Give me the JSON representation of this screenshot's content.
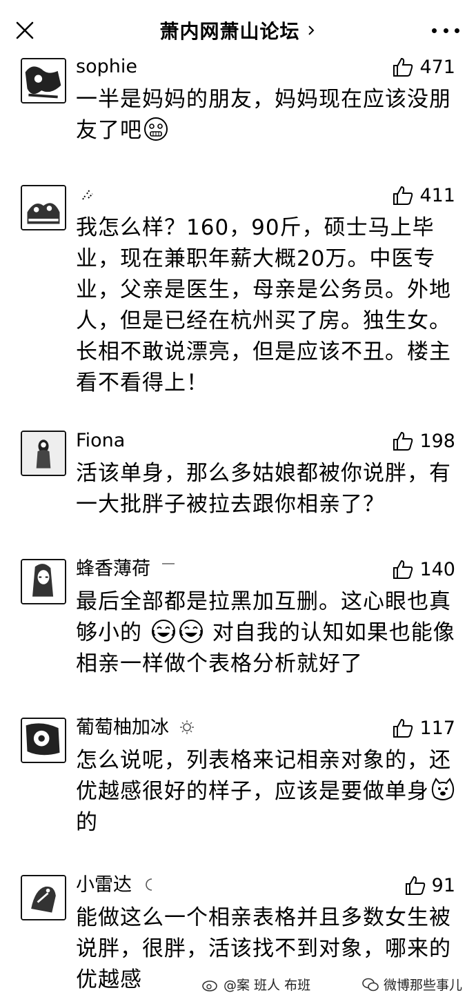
{
  "header": {
    "title": "萧内网萧山论坛",
    "close_icon": "close-icon",
    "more_icon": "more-icon"
  },
  "comments": [
    {
      "user": "sophie",
      "likes": "471",
      "text": "一半是妈妈的朋友，妈妈现在应该没朋友了吧",
      "emoji": "grimace-emoji"
    },
    {
      "user": "",
      "likes": "411",
      "text": "我怎么样？160，90斤，硕士马上毕业，现在兼职年薪大概20万。中医专业，父亲是医生，母亲是公务员。外地人，但是已经在杭州买了房。独生女。长相不敢说漂亮，但是应该不丑。楼主看不看得上！"
    },
    {
      "user": "Fiona",
      "likes": "198",
      "text": "活该单身，那么多姑娘都被你说胖，有一大批胖子被拉去跟你相亲了？"
    },
    {
      "user": "蜂香薄荷",
      "likes": "140",
      "text_a": "最后全部都是拉黑加互删。这心眼也真够小的",
      "text_b": "对自我的认知如果也能像相亲一样做个表格分析就好了",
      "emoji": "laugh-cry-emoji"
    },
    {
      "user": "葡萄柚加冰",
      "likes": "117",
      "text_a": "怎么说呢，列表格来记相亲对象的，还优越感很好的样子，应该是要做单身",
      "text_b": "的",
      "emoji": "doge-emoji"
    },
    {
      "user": "小雷达",
      "likes": "91",
      "text": "能做这么一个相亲表格并且多数女生被说胖，很胖，活该找不到对象，哪来的优越感"
    }
  ],
  "watermark": {
    "left": "@案 班人 布班",
    "right": "微博那些事儿"
  }
}
